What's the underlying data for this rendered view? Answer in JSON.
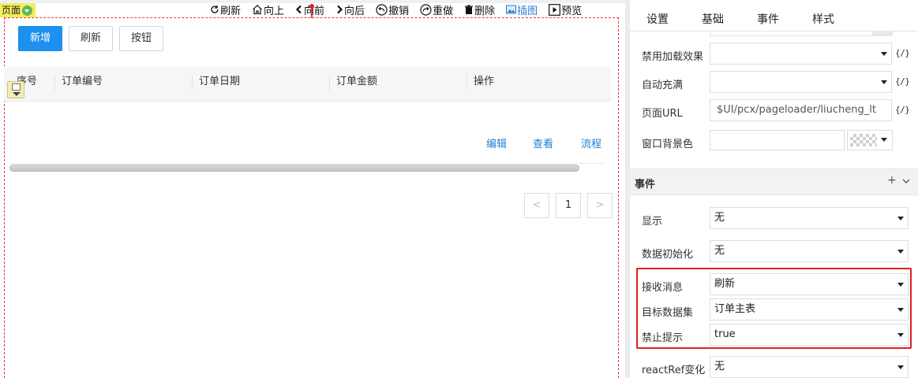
{
  "editor": {
    "page_tag": "页面",
    "toolbar": [
      {
        "label": "刷新",
        "icon": "refresh-icon"
      },
      {
        "label": "向上",
        "icon": "home-up-icon"
      },
      {
        "label": "向前",
        "icon": "chevron-left-icon"
      },
      {
        "label": "向后",
        "icon": "chevron-right-icon"
      },
      {
        "label": "撤销",
        "icon": "undo-icon"
      },
      {
        "label": "重做",
        "icon": "redo-icon"
      },
      {
        "label": "删除",
        "icon": "trash-icon"
      },
      {
        "label": "插图",
        "icon": "image-icon"
      },
      {
        "label": "预览",
        "icon": "play-icon"
      }
    ],
    "buttons": {
      "add": "新增",
      "refresh": "刷新",
      "button": "按钮"
    },
    "grid": {
      "columns": [
        "序号",
        "订单编号",
        "订单日期",
        "订单金额",
        "操作"
      ],
      "row_actions": [
        "编辑",
        "查看",
        "流程"
      ]
    },
    "pager": {
      "prev": "<",
      "page": "1",
      "next": ">"
    }
  },
  "panel": {
    "tabs": [
      "设置",
      "基础",
      "事件",
      "样式"
    ],
    "props": {
      "disable_loading": {
        "label": "禁用加载效果",
        "value": "",
        "expr": "{/}"
      },
      "auto_fill": {
        "label": "自动充满",
        "value": "",
        "expr": "{/}"
      },
      "page_url": {
        "label": "页面URL",
        "value": "$UI/pcx/pageloader/liucheng_lt",
        "expr": "{/}"
      },
      "window_bg": {
        "label": "窗口背景色",
        "value": ""
      }
    },
    "events_section": {
      "title": "事件",
      "plus": "+"
    },
    "events": {
      "show": {
        "label": "显示",
        "value": "无"
      },
      "data_init": {
        "label": "数据初始化",
        "value": "无"
      },
      "receive_msg": {
        "label": "接收消息",
        "value": "刷新"
      },
      "target_dataset": {
        "label": "目标数据集",
        "value": "订单主表"
      },
      "suppress_tip": {
        "label": "禁止提示",
        "value": "true"
      },
      "react_ref": {
        "label": "reactRef变化",
        "value": "无"
      }
    }
  },
  "colors": {
    "primary": "#1e90f0",
    "link": "#1e7fd0",
    "highlight": "#e02020",
    "page_tag_bg": "#f3ee5a"
  }
}
